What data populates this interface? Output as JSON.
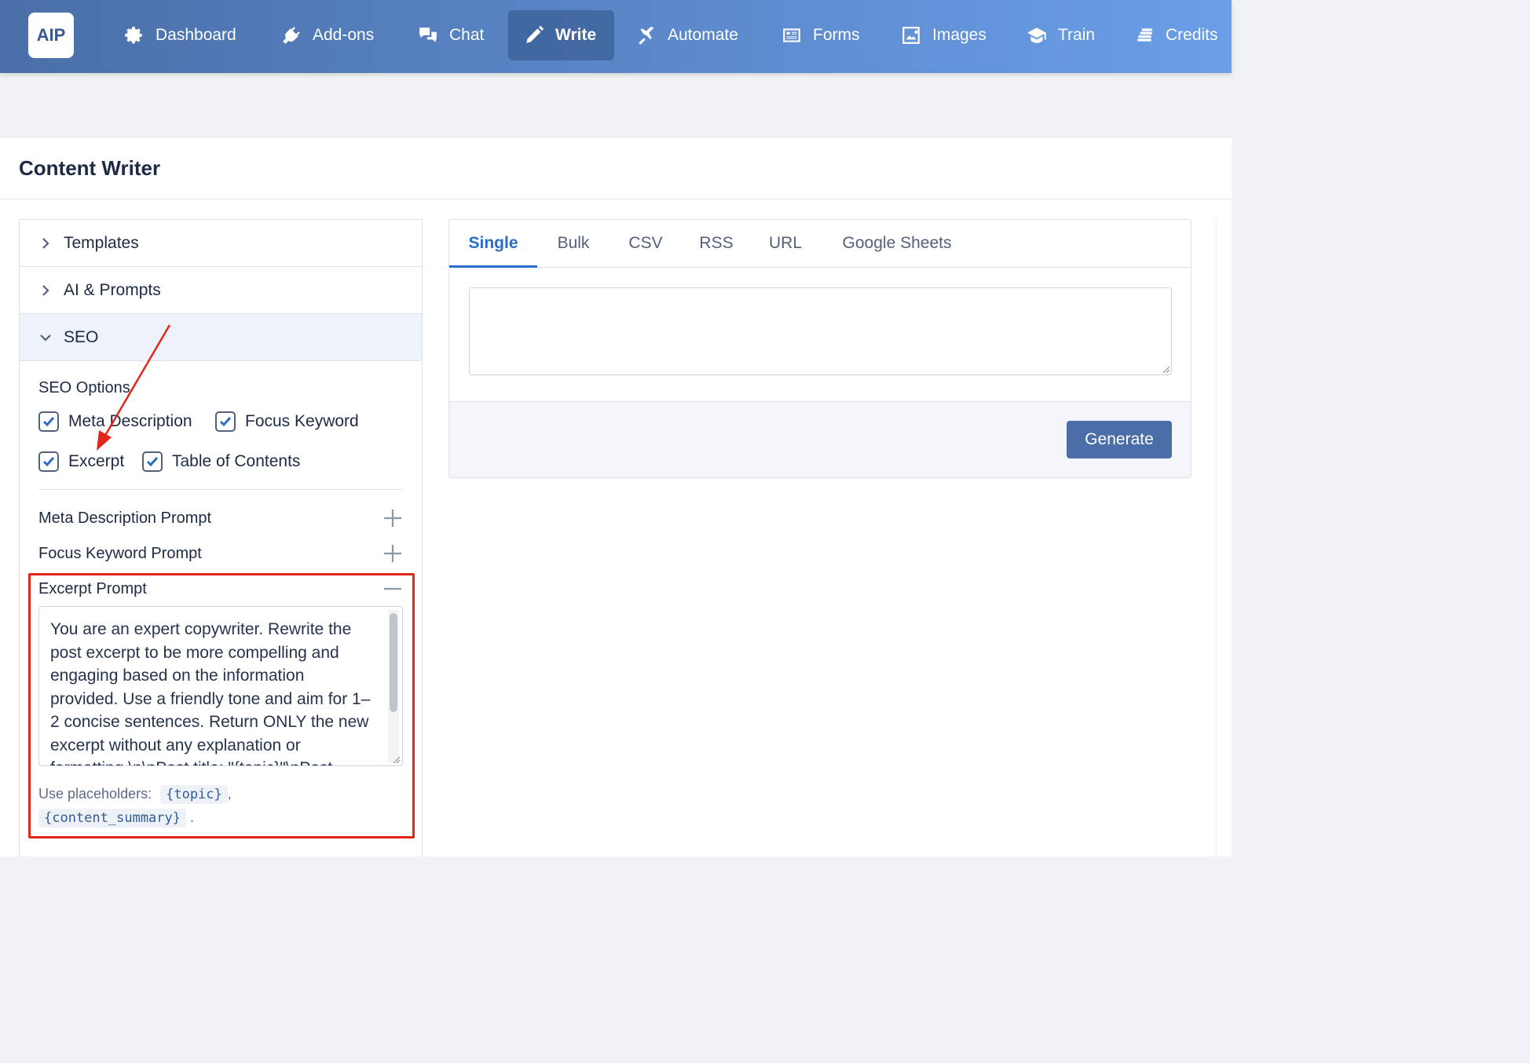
{
  "brand": {
    "logo_text": "AIP"
  },
  "nav": [
    {
      "label": "Dashboard",
      "icon": "gear-icon"
    },
    {
      "label": "Add-ons",
      "icon": "plug-icon"
    },
    {
      "label": "Chat",
      "icon": "chat-icon"
    },
    {
      "label": "Write",
      "icon": "pencil-icon",
      "active": true
    },
    {
      "label": "Automate",
      "icon": "plane-icon"
    },
    {
      "label": "Forms",
      "icon": "form-icon"
    },
    {
      "label": "Images",
      "icon": "image-icon"
    },
    {
      "label": "Train",
      "icon": "graduation-cap-icon"
    },
    {
      "label": "Credits",
      "icon": "coins-icon"
    }
  ],
  "page": {
    "title": "Content Writer"
  },
  "accordion": {
    "templates": "Templates",
    "ai_prompts": "AI & Prompts",
    "seo": "SEO"
  },
  "seo": {
    "options_heading": "SEO Options",
    "options": [
      {
        "label": "Meta Description",
        "checked": true
      },
      {
        "label": "Focus Keyword",
        "checked": true
      },
      {
        "label": "Excerpt",
        "checked": true
      },
      {
        "label": "Table of Contents",
        "checked": true
      }
    ],
    "meta_prompt_label": "Meta Description Prompt",
    "focus_prompt_label": "Focus Keyword Prompt",
    "excerpt_prompt_label": "Excerpt Prompt",
    "excerpt_prompt_value": "You are an expert copywriter. Rewrite the post excerpt to be more compelling and engaging based on the information provided. Use a friendly tone and aim for 1–2 concise sentences. Return ONLY the new excerpt without any explanation or formatting.\\n\\nPost title: \"{topic}\"\\nPost",
    "placeholders_label": "Use placeholders:",
    "placeholder_1": "{topic}",
    "placeholder_2": "{content_summary}",
    "sep_comma": ",",
    "sep_period": "."
  },
  "tabs": [
    "Single",
    "Bulk",
    "CSV",
    "RSS",
    "URL",
    "Google Sheets"
  ],
  "single": {
    "topic_value": ""
  },
  "actions": {
    "generate": "Generate"
  },
  "colors": {
    "accent": "#2a6dc8",
    "annotation": "#e3261c",
    "button": "#4a6ea8"
  }
}
